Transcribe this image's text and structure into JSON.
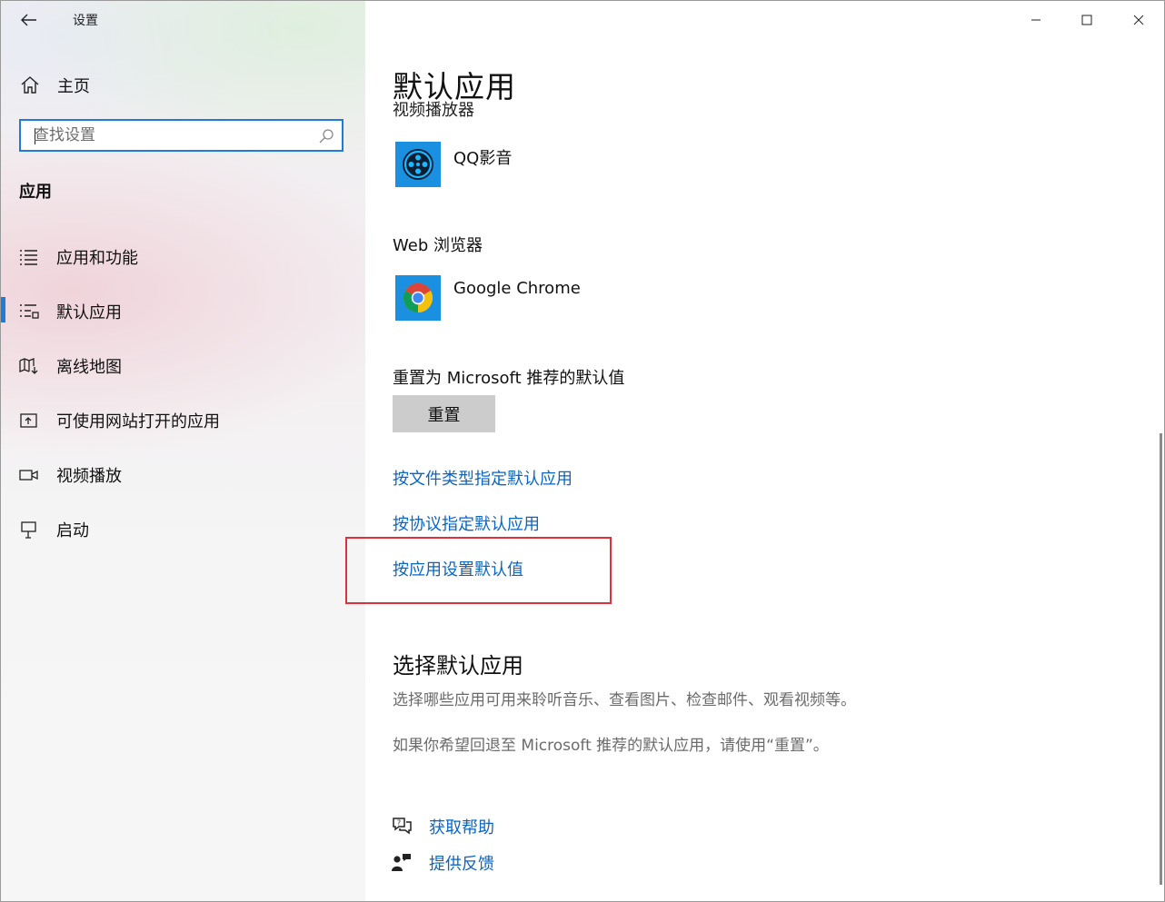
{
  "window": {
    "title": "设置"
  },
  "sidebar": {
    "home_label": "主页",
    "search_placeholder": "查找设置",
    "section": "应用",
    "items": [
      {
        "label": "应用和功能",
        "icon": "apps-features-icon"
      },
      {
        "label": "默认应用",
        "icon": "default-apps-icon",
        "selected": true
      },
      {
        "label": "离线地图",
        "icon": "offline-maps-icon"
      },
      {
        "label": "可使用网站打开的应用",
        "icon": "apps-for-websites-icon"
      },
      {
        "label": "视频播放",
        "icon": "video-playback-icon"
      },
      {
        "label": "启动",
        "icon": "startup-icon"
      }
    ]
  },
  "main": {
    "title": "默认应用",
    "video_player": {
      "heading": "视频播放器",
      "app": "QQ影音"
    },
    "web_browser": {
      "heading": "Web 浏览器",
      "app": "Google Chrome"
    },
    "reset": {
      "heading": "重置为 Microsoft 推荐的默认值",
      "button": "重置"
    },
    "links": [
      "按文件类型指定默认应用",
      "按协议指定默认应用",
      "按应用设置默认值"
    ],
    "choose_section": {
      "title": "选择默认应用",
      "line1": "选择哪些应用可用来聆听音乐、查看图片、检查邮件、观看视频等。",
      "line2": "如果你希望回退至 Microsoft 推荐的默认应用，请使用“重置”。"
    },
    "help": {
      "get_help": "获取帮助",
      "feedback": "提供反馈"
    }
  },
  "colors": {
    "accent": "#1f7bd6",
    "link": "#0a66c2",
    "highlight": "#e1303a"
  }
}
